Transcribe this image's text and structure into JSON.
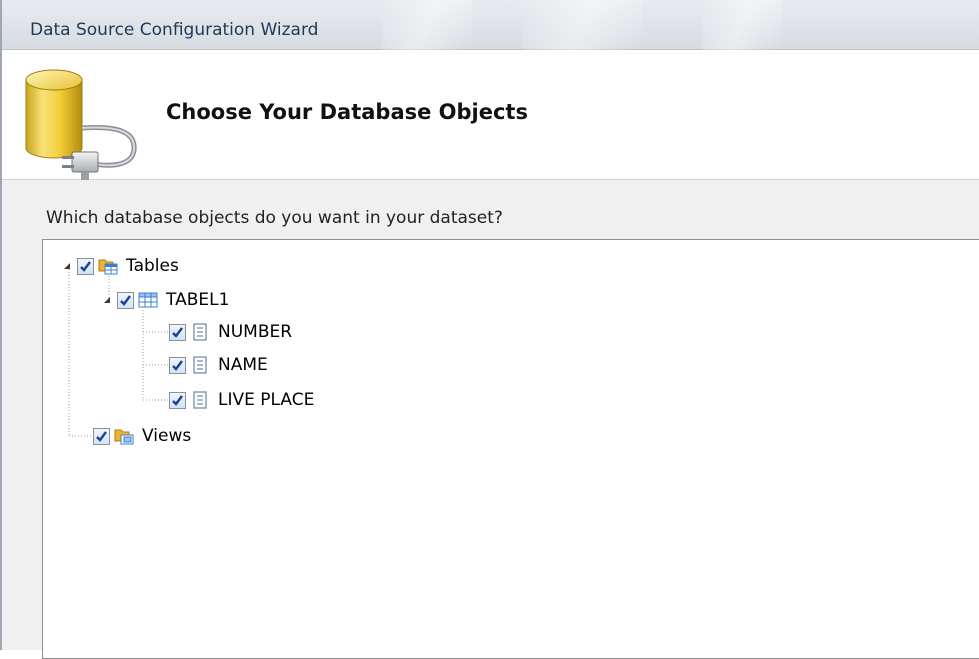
{
  "window": {
    "title": "Data Source Configuration Wizard"
  },
  "header": {
    "title": "Choose Your Database Objects",
    "icon": "database-plug-icon"
  },
  "prompt": "Which database objects do you want in your dataset?",
  "tree": {
    "tables": {
      "label": "Tables",
      "checked": true,
      "expanded": true,
      "icon": "tables-folder-icon"
    },
    "tabel1": {
      "label": "TABEL1",
      "checked": true,
      "expanded": true,
      "icon": "table-grid-icon"
    },
    "columns": [
      {
        "label": "NUMBER",
        "checked": true,
        "icon": "column-icon"
      },
      {
        "label": "NAME",
        "checked": true,
        "icon": "column-icon"
      },
      {
        "label": "LIVE PLACE",
        "checked": true,
        "icon": "column-icon"
      }
    ],
    "views": {
      "label": "Views",
      "checked": true,
      "icon": "views-folder-icon"
    }
  },
  "colors": {
    "title_text": "#1e3957",
    "check_mark": "#1f3f8f",
    "folder": "#f0b429",
    "table_blue": "#3c7fcf"
  }
}
